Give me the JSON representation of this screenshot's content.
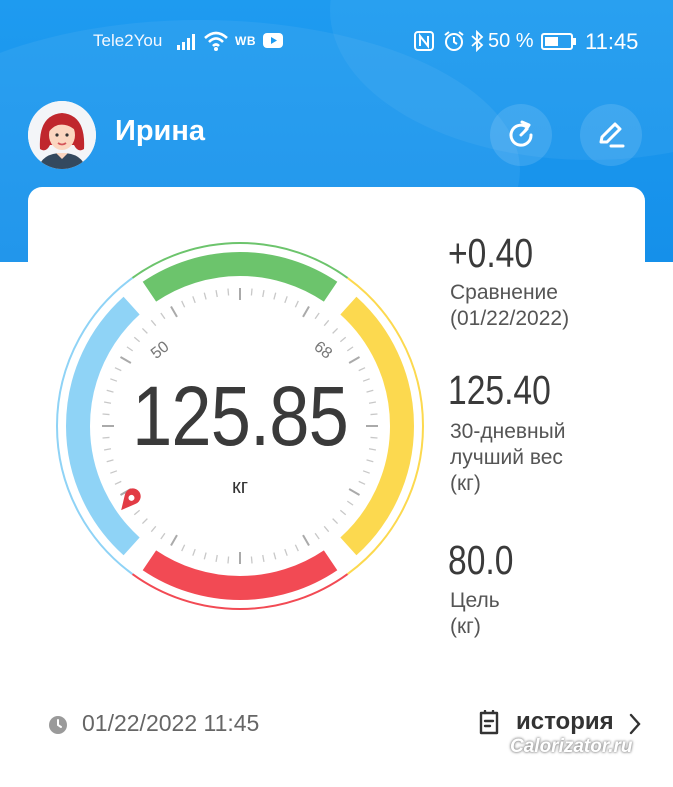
{
  "status_bar": {
    "carrier": "Tele2You",
    "extra_label": "WB",
    "battery": "50 %",
    "time": "11:45"
  },
  "header": {
    "user_name": "Ирина"
  },
  "gauge": {
    "value": "125.85",
    "unit": "кг",
    "tick_left": "50",
    "tick_right": "68"
  },
  "stats": [
    {
      "value": "+0.40",
      "label": [
        "Сравнение",
        "(01/22/2022)"
      ]
    },
    {
      "value": "125.40",
      "label": [
        "30-дневный",
        "лучший вес",
        "(кг)"
      ]
    },
    {
      "value": "80.0",
      "label": [
        "Цель",
        "(кг)"
      ]
    }
  ],
  "footer": {
    "datetime": "01/22/2022 11:45",
    "history_label": "история"
  },
  "watermark": "Calorizator.ru",
  "colors": {
    "header_blue": "#1e9bf0",
    "arc_green": "#6cc46c",
    "arc_yellow": "#fcd94f",
    "arc_red": "#f24a54",
    "arc_blue": "#8fd3f6"
  }
}
